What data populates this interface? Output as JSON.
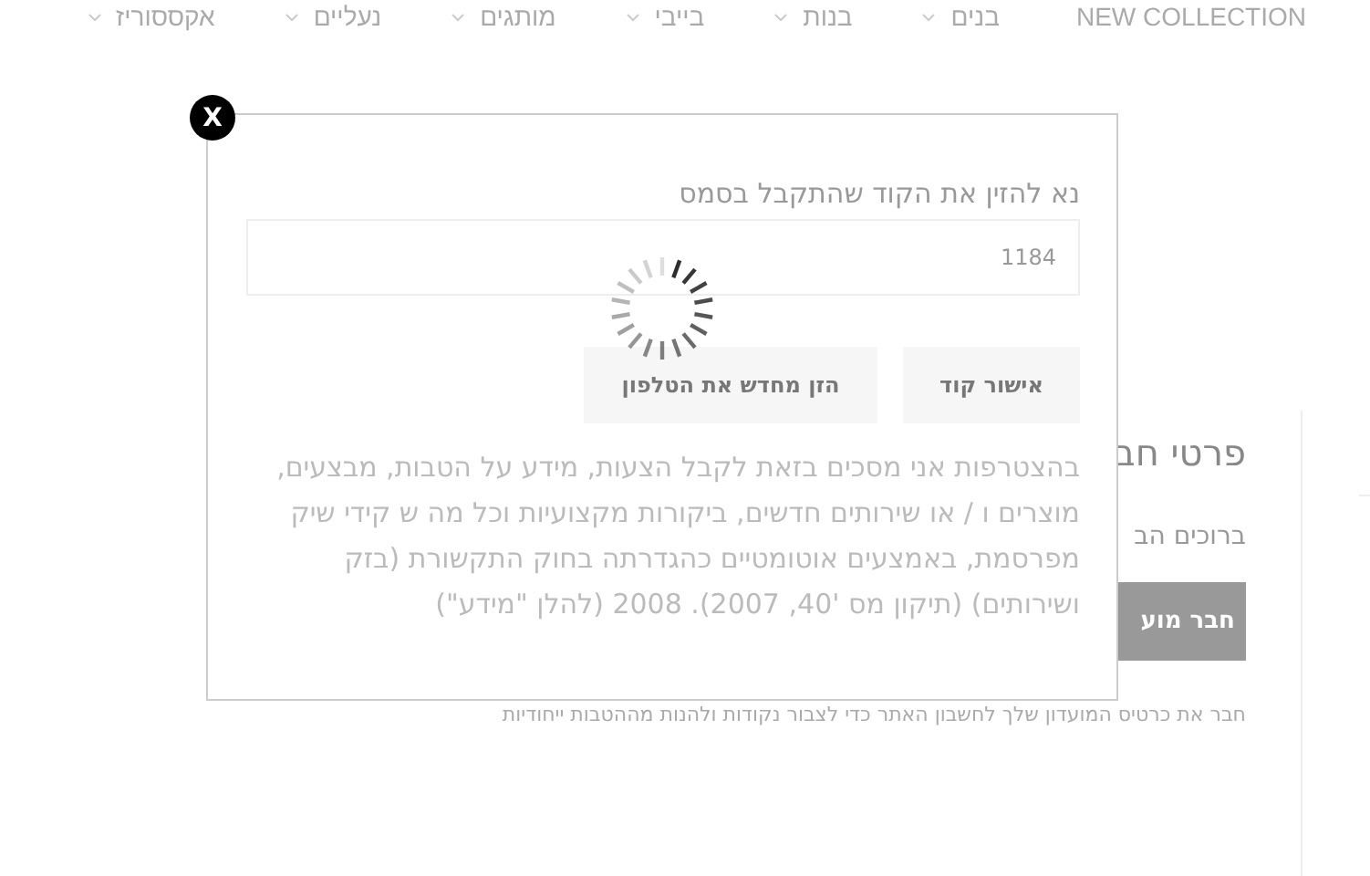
{
  "nav": [
    {
      "label": "NEW COLLECTION",
      "dropdown": false
    },
    {
      "label": "בנים",
      "dropdown": true
    },
    {
      "label": "בנות",
      "dropdown": true
    },
    {
      "label": "בייבי",
      "dropdown": true
    },
    {
      "label": "מותגים",
      "dropdown": true
    },
    {
      "label": "נעליים",
      "dropdown": true
    },
    {
      "label": "אקססוריז",
      "dropdown": true
    }
  ],
  "member_panel": {
    "heading": "פרטי חב",
    "welcome": "ברוכים הב",
    "button": "חבר מוע",
    "note": "חבר את כרטיס המועדון שלך לחשבון האתר כדי לצבור נקודות ולהנות מההטבות ייחודיות"
  },
  "modal": {
    "close": "X",
    "label": "נא להזין את הקוד שהתקבל בסמס",
    "code": {
      "value": "1184"
    },
    "loading": true,
    "buttons": [
      "אישור קוד",
      "הזן מחדש את הטלפון"
    ],
    "consent": "בהצטרפות אני מסכים בזאת לקבל הצעות, מידע על הטבות, מבצעים, מוצרים ו / או שירותים חדשים, ביקורות מקצועיות וכל מה ש קידי שיק מפרסמת, באמצעים אוטומטיים כהגדרתה בחוק התקשורת (בזק ושירותים) (תיקון מס '40, 2007). 2008 (להלן \"מידע\")"
  }
}
